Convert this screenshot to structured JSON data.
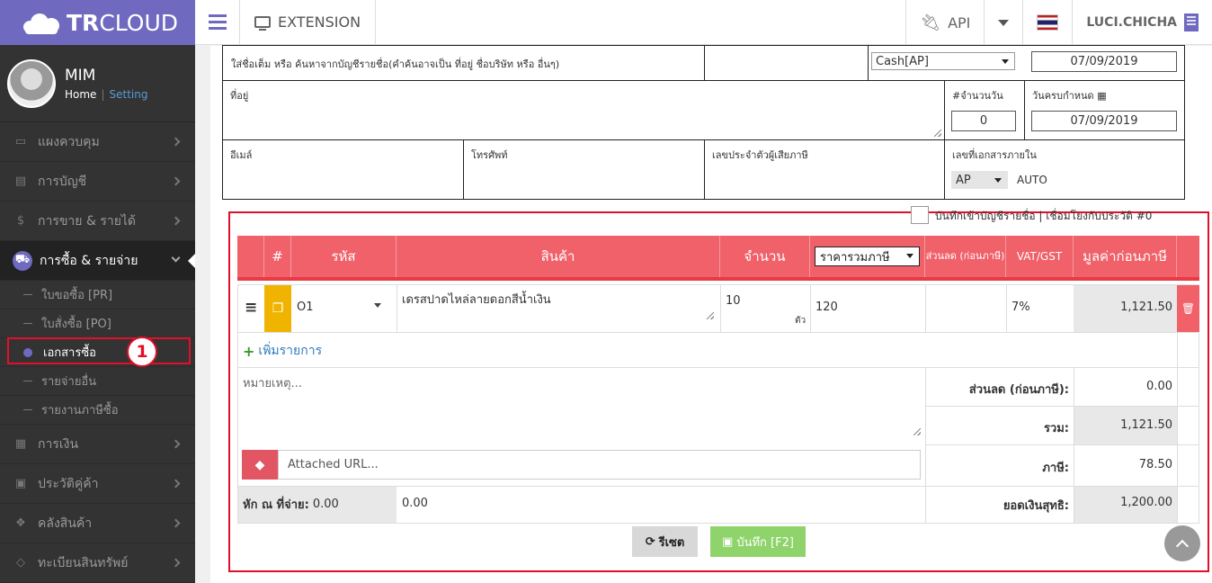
{
  "app": {
    "brand_bold": "TR",
    "brand_light": "CLOUD"
  },
  "profile": {
    "name": "MIM",
    "home": "Home",
    "separator": "|",
    "setting": "Setting"
  },
  "sidebar": {
    "items": [
      {
        "label": "แผงควบคุม",
        "icon": "monitor-icon"
      },
      {
        "label": "การบัญชี",
        "icon": "book-icon"
      },
      {
        "label": "การขาย & รายได้",
        "icon": "dollar-icon"
      },
      {
        "label": "การซื้อ & รายจ่าย",
        "icon": "cart-icon",
        "active": true
      },
      {
        "label": "การเงิน",
        "icon": "calendar-icon"
      },
      {
        "label": "ประวัติคู่ค้า",
        "icon": "contact-icon"
      },
      {
        "label": "คลังสินค้า",
        "icon": "boxes-icon"
      },
      {
        "label": "ทะเบียนสินทรัพย์",
        "icon": "gem-icon"
      }
    ],
    "subitems": [
      {
        "label": "ใบขอซื้อ [PR]"
      },
      {
        "label": "ใบสั่งซื้อ [PO]"
      },
      {
        "label": "เอกสารซื้อ",
        "active": true
      },
      {
        "label": "รายจ่ายอื่น"
      },
      {
        "label": "รายงานภาษีซื้อ"
      }
    ],
    "callout_number": "1"
  },
  "topbar": {
    "extension": "EXTENSION",
    "api": "API",
    "user": "LUCI.CHICHA"
  },
  "form": {
    "search_placeholder": "ใส่ชื่อเต็ม หรือ ค้นหาจากบัญชีรายชื่อ(คำค้นอาจเป็น ที่อยู่ ชื่อบริษัท หรือ อื่นๆ)",
    "account_select": "Cash[AP]",
    "doc_date": "07/09/2019",
    "address_label": "ที่อยู่",
    "days_label": "#จำนวนวัน",
    "days_value": "0",
    "due_label": "วันครบกำหนด",
    "due_date": "07/09/2019",
    "email_label": "อีเมล์",
    "phone_label": "โทรศัพท์",
    "taxid_label": "เลขประจำตัวผู้เสียภาษี",
    "internal_doc_label": "เลขที่เอกสารภายใน",
    "internal_prefix": "AP",
    "internal_auto": "AUTO",
    "save_contact_label": "บันทึกเข้าบัญชีรายชื่อ | เชื่อมโยงกับประวัติ #0"
  },
  "items": {
    "headers": {
      "num": "#",
      "code": "รหัส",
      "product": "สินค้า",
      "qty": "จำนวน",
      "price_mode": "ราคารวมภาษี",
      "discount": "ส่วนลด (ก่อนภาษี)",
      "vat": "VAT/GST",
      "pretax": "มูลค่าก่อนภาษี"
    },
    "rows": [
      {
        "code": "O1",
        "product": "เดรสปาดไหล่ลายดอกสีน้ำเงิน",
        "qty": "10",
        "unit": "ตัว",
        "price": "120",
        "discount": "",
        "vat": "7%",
        "pretax": "1,121.50"
      }
    ],
    "add_label": "เพิ่มรายการ"
  },
  "summary": {
    "note_placeholder": "หมายเหตุ...",
    "url_placeholder": "Attached URL...",
    "discount_label": "ส่วนลด (ก่อนภาษี):",
    "discount_value": "0.00",
    "total_label": "รวม:",
    "total_value": "1,121.50",
    "tax_label": "ภาษี:",
    "tax_value": "78.50",
    "withholding_label": "หัก ณ ที่จ่าย:",
    "withholding_amount": "0.00",
    "withholding_value": "0.00",
    "net_label": "ยอดเงินสุทธิ:",
    "net_value": "1,200.00"
  },
  "buttons": {
    "reset": "รีเซต",
    "save": "บันทึก [F2]"
  }
}
